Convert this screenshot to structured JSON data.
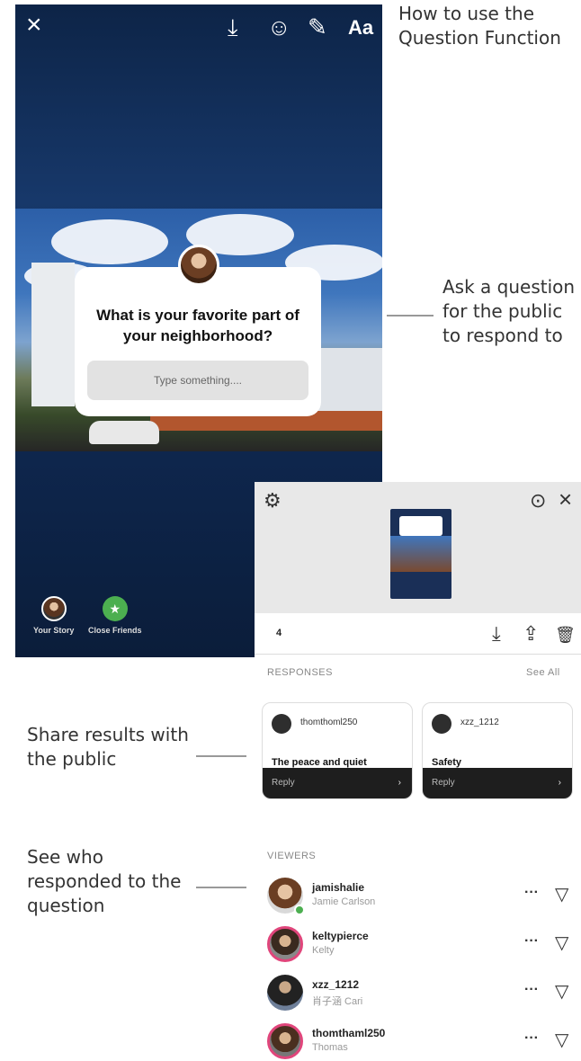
{
  "annotations": {
    "title": "How to use the Question Function",
    "ask": "Ask a question for the public to respond to",
    "share": "Share results with the public",
    "see": "See who responded to the question"
  },
  "story_editor": {
    "toolbar": {
      "close_icon": "×",
      "download_icon": "⤓",
      "sticker_icon": "☺",
      "draw_icon": "✎",
      "text_label": "Aa"
    },
    "question_sticker": {
      "question": "What is your favorite part of your neighborhood?",
      "placeholder": "Type something...."
    },
    "share_to": [
      {
        "label": "Your Story"
      },
      {
        "label": "Close Friends",
        "icon": "★"
      }
    ]
  },
  "results": {
    "top": {
      "settings_icon": "⚙",
      "more_icon": "⊙",
      "close_icon": "×"
    },
    "viewer_count": "4",
    "actions": {
      "download_icon": "⤓",
      "share_icon": "⇪",
      "delete_icon": "🗑"
    },
    "responses": {
      "heading": "RESPONSES",
      "see_all": "See All",
      "cards": [
        {
          "user": "thomthoml250",
          "answer": "The peace and quiet",
          "reply": "Reply",
          "chevron": "›"
        },
        {
          "user": "xzz_1212",
          "answer": "Safety",
          "reply": "Reply",
          "chevron": "›"
        }
      ]
    },
    "viewers": {
      "heading": "VIEWERS",
      "items": [
        {
          "user": "jamishalie",
          "name": "Jamie Carlson",
          "more": "···",
          "send": "▽"
        },
        {
          "user": "keltypierce",
          "name": "Kelty",
          "more": "···",
          "send": "▽"
        },
        {
          "user": "xzz_1212",
          "name": "肖子涵 Cari",
          "more": "···",
          "send": "▽"
        },
        {
          "user": "thomthaml250",
          "name": "Thomas",
          "more": "···",
          "send": "▽"
        }
      ]
    }
  },
  "colors": {
    "accent_green": "#4caf50",
    "story_ring": "#e0457b",
    "phone_bg": "#0f2a55"
  }
}
